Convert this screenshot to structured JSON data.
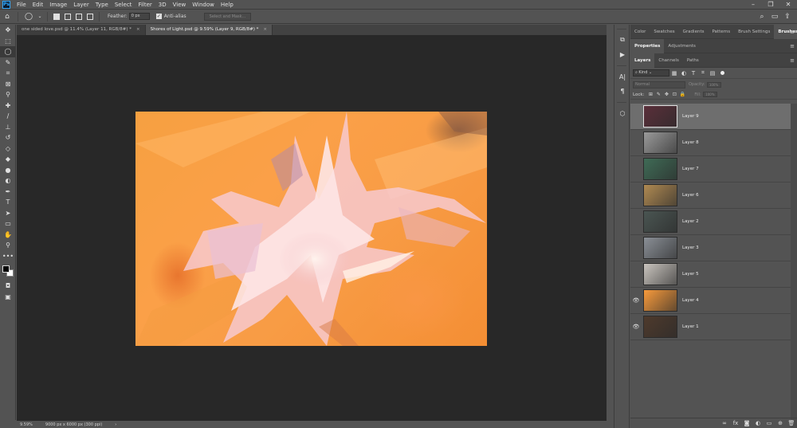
{
  "app": {
    "logo": "Ps"
  },
  "menu": [
    "File",
    "Edit",
    "Image",
    "Layer",
    "Type",
    "Select",
    "Filter",
    "3D",
    "View",
    "Window",
    "Help"
  ],
  "window_controls": {
    "minimize": "–",
    "restore": "❐",
    "close": "✕"
  },
  "options": {
    "feather_label": "Feather:",
    "feather_value": "0 px",
    "antialias_label": "Anti-alias",
    "select_mask_button": "Select and Mask..."
  },
  "tabs": [
    {
      "label": "one sided love.psd @ 11.4% (Layer 11, RGB/8#) *",
      "close": "×"
    },
    {
      "label": "Shores of Light.psd @ 9.59% (Layer 9, RGB/8#) *",
      "close": "×"
    }
  ],
  "status": {
    "zoom": "9.59%",
    "doc_size": "9000 px x 6000 px (300 ppi)",
    "arrow": "›"
  },
  "panels": {
    "top_tabs": [
      "Color",
      "Swatches",
      "Gradients",
      "Patterns",
      "Brush Settings",
      "Brushes"
    ],
    "mid_tabs": [
      "Properties",
      "Adjustments"
    ],
    "layer_tabs": [
      "Layers",
      "Channels",
      "Paths"
    ],
    "kind_label": "Kind",
    "blend_mode": "Normal",
    "opacity_label": "Opacity:",
    "opacity_value": "100%",
    "lock_label": "Lock:",
    "fill_label": "Fill:",
    "fill_value": "100%"
  },
  "layers": [
    {
      "name": "Layer 9",
      "visible": false,
      "selected": true,
      "thumb": "#5a2f3a"
    },
    {
      "name": "Layer 8",
      "visible": false,
      "selected": false,
      "thumb": "#9a9a9a"
    },
    {
      "name": "Layer 7",
      "visible": false,
      "selected": false,
      "thumb": "#3f6b56"
    },
    {
      "name": "Layer 6",
      "visible": false,
      "selected": false,
      "thumb": "#b08a52"
    },
    {
      "name": "Layer 2",
      "visible": false,
      "selected": false,
      "thumb": "#4a5552"
    },
    {
      "name": "Layer 3",
      "visible": false,
      "selected": false,
      "thumb": "#8a8f96"
    },
    {
      "name": "Layer 5",
      "visible": false,
      "selected": false,
      "thumb": "#c9c4be"
    },
    {
      "name": "Layer 4",
      "visible": true,
      "selected": false,
      "thumb": "#f79a3c"
    },
    {
      "name": "Layer 1",
      "visible": true,
      "selected": false,
      "thumb": "#4e3a2c"
    }
  ],
  "icons": {
    "eye": "👁",
    "menu": "≡"
  }
}
